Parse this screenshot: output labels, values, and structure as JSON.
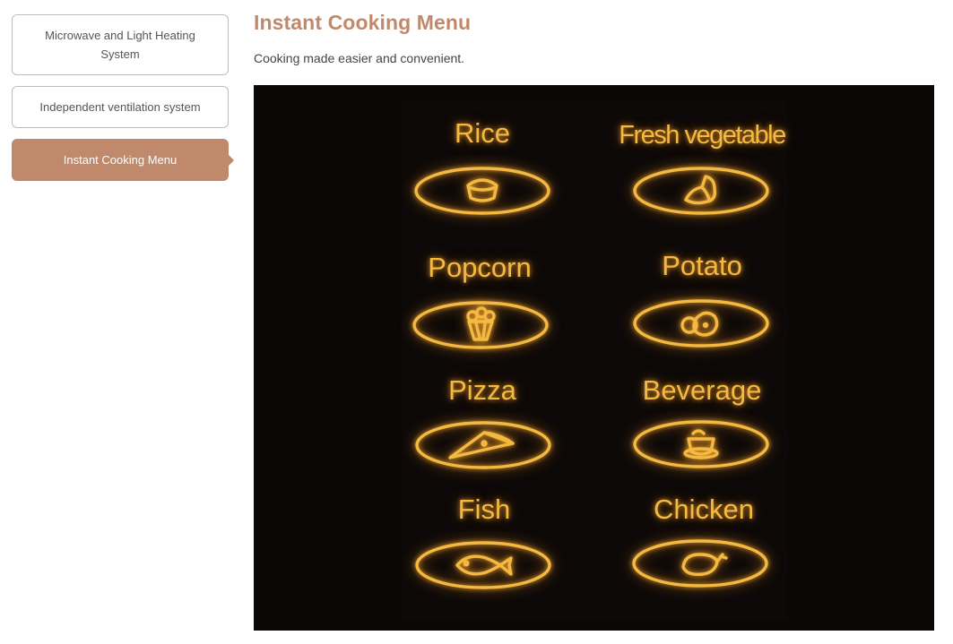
{
  "sidebar": {
    "tabs": [
      {
        "label": "Microwave and Light Heating System"
      },
      {
        "label": "Independent ventilation system"
      },
      {
        "label": "Instant Cooking Menu",
        "active": true
      }
    ]
  },
  "content": {
    "title": "Instant Cooking Menu",
    "subtitle": "Cooking made easier and convenient."
  },
  "menu": {
    "items": [
      {
        "label": "Rice",
        "icon": "rice-bowl-icon"
      },
      {
        "label": "Fresh vegetable",
        "icon": "vegetable-icon"
      },
      {
        "label": "Popcorn",
        "icon": "popcorn-icon"
      },
      {
        "label": "Potato",
        "icon": "potato-icon"
      },
      {
        "label": "Pizza",
        "icon": "pizza-slice-icon"
      },
      {
        "label": "Beverage",
        "icon": "beverage-cup-icon"
      },
      {
        "label": "Fish",
        "icon": "fish-icon"
      },
      {
        "label": "Chicken",
        "icon": "chicken-icon"
      }
    ]
  },
  "colors": {
    "accent": "#c0896b",
    "panel_bg": "#0b0706",
    "glow": "#f4b942"
  }
}
